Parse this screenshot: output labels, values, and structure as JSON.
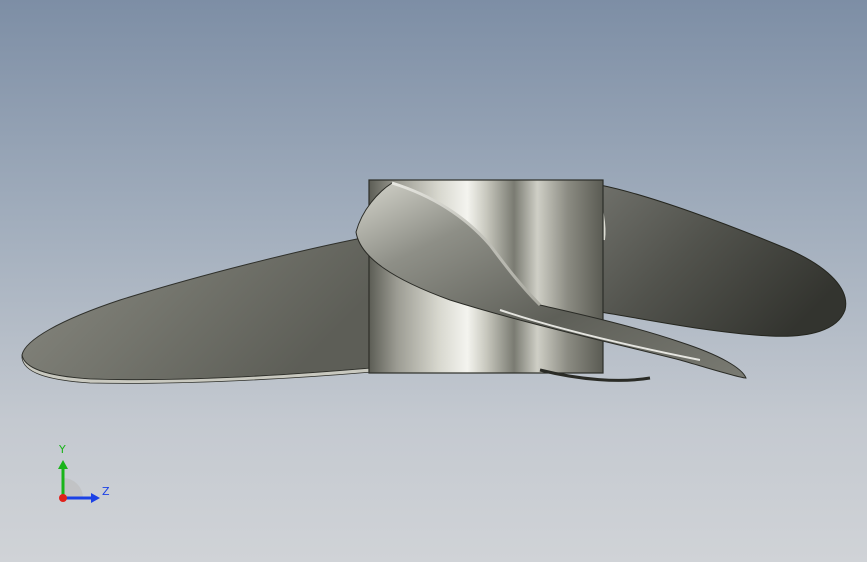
{
  "triad": {
    "y_label": "Y",
    "z_label": "Z"
  },
  "colors": {
    "background_top": "#7d8ea5",
    "background_bottom": "#d0d3d7",
    "y_axis": "#19b419",
    "z_axis": "#1b41e6",
    "origin": "#e0201a",
    "metal_light": "#f1f1ec",
    "metal_dark": "#3f413b"
  },
  "model": {
    "part": "propeller",
    "blades": 3
  }
}
